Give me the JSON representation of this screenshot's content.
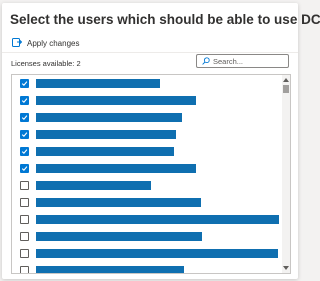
{
  "dialog": {
    "title": "Select the users which should be able to use DCP"
  },
  "toolbar": {
    "apply_label": "Apply changes",
    "apply_icon": "apply-changes-icon"
  },
  "licenses": {
    "text": "Licenses available: 2"
  },
  "search": {
    "placeholder": "Search...",
    "value": "",
    "icon": "search-icon"
  },
  "colors": {
    "accent": "#0078d4",
    "redaction_bar": "#0f6fb0",
    "border": "#c8c6c4"
  },
  "users": [
    {
      "checked": true,
      "name_width": 124
    },
    {
      "checked": true,
      "name_width": 160
    },
    {
      "checked": true,
      "name_width": 146
    },
    {
      "checked": true,
      "name_width": 140
    },
    {
      "checked": true,
      "name_width": 138
    },
    {
      "checked": true,
      "name_width": 160
    },
    {
      "checked": false,
      "name_width": 115
    },
    {
      "checked": false,
      "name_width": 165
    },
    {
      "checked": false,
      "name_width": 243
    },
    {
      "checked": false,
      "name_width": 166
    },
    {
      "checked": false,
      "name_width": 242
    },
    {
      "checked": false,
      "name_width": 148
    }
  ]
}
